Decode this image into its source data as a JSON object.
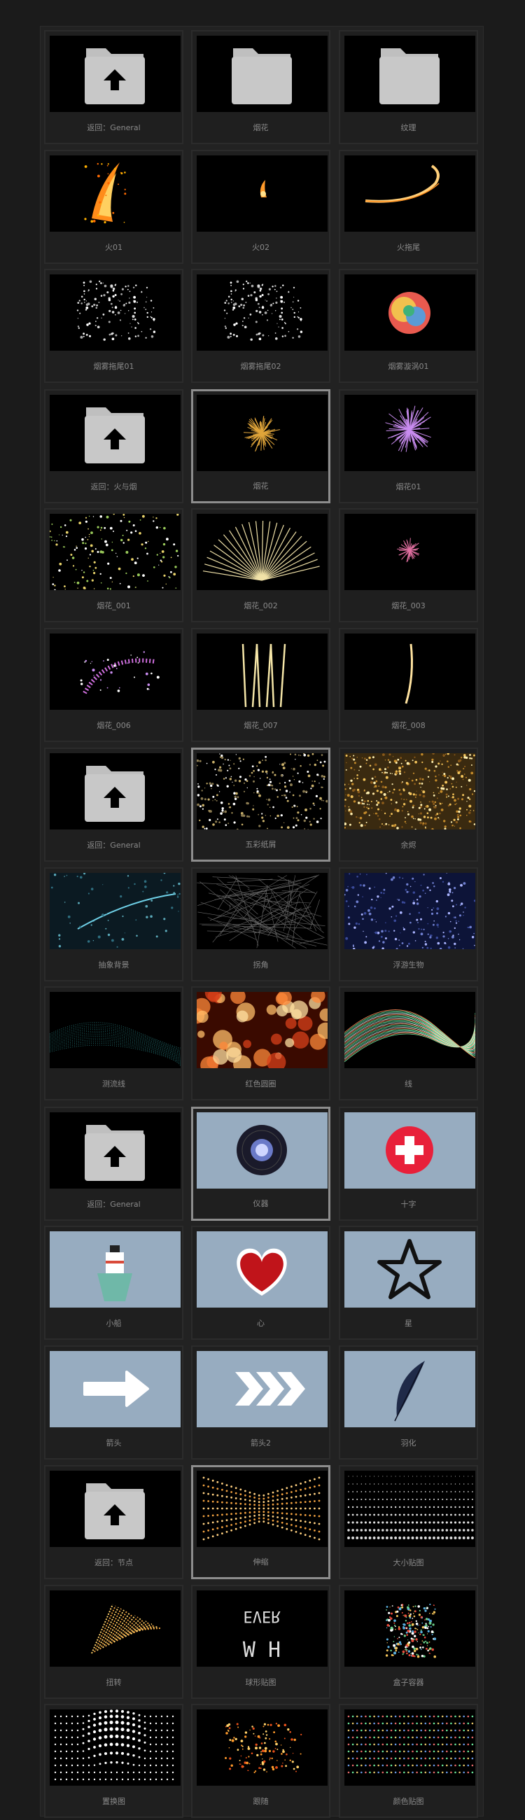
{
  "tiles": [
    {
      "label": "返回：General",
      "icon": "folder-up-icon"
    },
    {
      "label": "烟花",
      "icon": "folder-icon"
    },
    {
      "label": "纹理",
      "icon": "folder-icon"
    },
    {
      "label": "火01",
      "icon": "fire-icon"
    },
    {
      "label": "火02",
      "icon": "small-flame-icon"
    },
    {
      "label": "火拖尾",
      "icon": "fire-trail-icon"
    },
    {
      "label": "烟雾拖尾01",
      "icon": "smoke-trail-icon"
    },
    {
      "label": "烟雾拖尾02",
      "icon": "smoke-trail-icon"
    },
    {
      "label": "烟雾漩涡01",
      "icon": "smoke-swirl-icon"
    },
    {
      "label": "返回：火与烟",
      "icon": "folder-up-icon"
    },
    {
      "label": "烟花",
      "icon": "firework-gold-icon",
      "selected": true
    },
    {
      "label": "烟花01",
      "icon": "firework-purple-icon"
    },
    {
      "label": "烟花_001",
      "icon": "sparkle-field-icon"
    },
    {
      "label": "烟花_002",
      "icon": "firework-fan-icon"
    },
    {
      "label": "烟花_003",
      "icon": "firework-small-icon"
    },
    {
      "label": "烟花_006",
      "icon": "firework-arc-icon"
    },
    {
      "label": "烟花_007",
      "icon": "firework-streaks-icon"
    },
    {
      "label": "烟花_008",
      "icon": "firework-single-streak-icon"
    },
    {
      "label": "返回：General",
      "icon": "folder-up-icon"
    },
    {
      "label": "五彩纸屑",
      "icon": "confetti-icon",
      "selected": true
    },
    {
      "label": "余烬",
      "icon": "embers-icon"
    },
    {
      "label": "抽象背景",
      "icon": "abstract-bg-icon"
    },
    {
      "label": "拐角",
      "icon": "corner-lines-icon"
    },
    {
      "label": "浮游生物",
      "icon": "plankton-icon"
    },
    {
      "label": "测流线",
      "icon": "flow-lines-icon"
    },
    {
      "label": "红色圆圈",
      "icon": "red-bokeh-icon"
    },
    {
      "label": "线",
      "icon": "lines-icon"
    },
    {
      "label": "返回：General",
      "icon": "folder-up-icon"
    },
    {
      "label": "仪器",
      "icon": "vinyl-record-icon",
      "selected": true
    },
    {
      "label": "十字",
      "icon": "red-cross-icon"
    },
    {
      "label": "小船",
      "icon": "ship-icon"
    },
    {
      "label": "心",
      "icon": "heart-icon"
    },
    {
      "label": "星",
      "icon": "star-icon"
    },
    {
      "label": "箭头",
      "icon": "arrow-icon"
    },
    {
      "label": "箭头2",
      "icon": "chevrons-icon"
    },
    {
      "label": "羽化",
      "icon": "feather-icon"
    },
    {
      "label": "返回：节点",
      "icon": "folder-up-icon"
    },
    {
      "label": "伸缩",
      "icon": "stretch-dots-icon",
      "selected": true
    },
    {
      "label": "大小贴图",
      "icon": "size-map-icon"
    },
    {
      "label": "扭转",
      "icon": "twist-icon"
    },
    {
      "label": "球形贴图",
      "icon": "sphere-map-icon"
    },
    {
      "label": "盒子容器",
      "icon": "box-container-icon"
    },
    {
      "label": "置换图",
      "icon": "displacement-icon"
    },
    {
      "label": "跟随",
      "icon": "follow-icon"
    },
    {
      "label": "颜色贴图",
      "icon": "color-map-icon"
    }
  ]
}
